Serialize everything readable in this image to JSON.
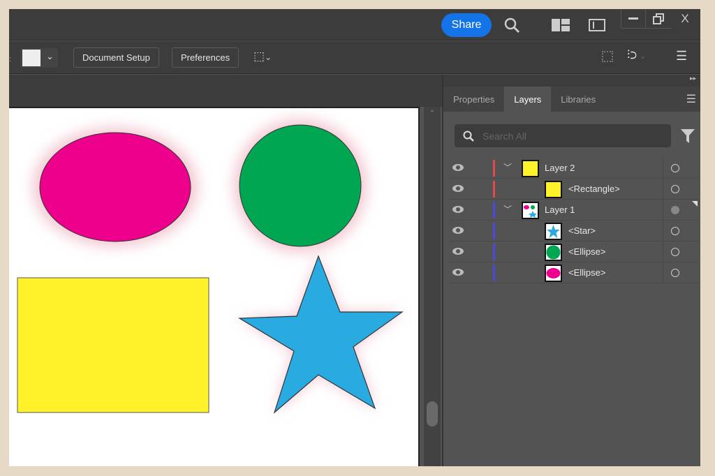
{
  "titlebar": {
    "share_label": "Share",
    "icons": [
      "search-icon",
      "workspace-icon",
      "panel-icon",
      "minimize-icon",
      "restore-icon",
      "close-icon"
    ],
    "close_label": "X"
  },
  "controlbar": {
    "document_setup": "Document Setup",
    "preferences": "Preferences",
    "fill_color": "#eeeeee"
  },
  "panel": {
    "tabs": [
      {
        "label": "Properties"
      },
      {
        "label": "Layers"
      },
      {
        "label": "Libraries"
      }
    ],
    "active_tab": "Layers",
    "search_placeholder": "Search All",
    "layers": [
      {
        "name": "Layer 2",
        "type": "layer",
        "color": "#e04a4a",
        "thumb": "rectangle"
      },
      {
        "name": "<Rectangle>",
        "type": "item",
        "color": "#e04a4a",
        "thumb": "rectangle"
      },
      {
        "name": "Layer 1",
        "type": "layer",
        "color": "#4a4ae0",
        "thumb": "mixed"
      },
      {
        "name": "<Star>",
        "type": "item",
        "color": "#4a4ae0",
        "thumb": "star"
      },
      {
        "name": "<Ellipse>",
        "type": "item",
        "color": "#4a4ae0",
        "thumb": "circle"
      },
      {
        "name": "<Ellipse>",
        "type": "item",
        "color": "#4a4ae0",
        "thumb": "ellipse"
      }
    ]
  },
  "artwork": {
    "ellipse_color": "#ec008c",
    "circle_color": "#00a651",
    "rectangle_color": "#fff22b",
    "star_color": "#29abe2",
    "glow_color": "#e8a0b0"
  }
}
